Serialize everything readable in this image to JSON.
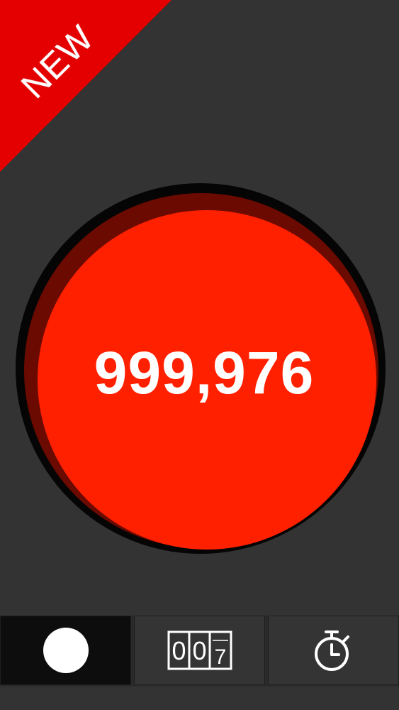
{
  "ribbon": {
    "label": "NEW",
    "color": "#e40000"
  },
  "counter": {
    "value": "999,976",
    "button_color": "#ff2000"
  },
  "tabs": [
    {
      "name": "tap-counter",
      "icon": "circle-dot-icon",
      "active": true
    },
    {
      "name": "tally-counter",
      "icon": "digit-counter-icon",
      "digits": [
        "0",
        "0",
        "7"
      ],
      "active": false
    },
    {
      "name": "stopwatch",
      "icon": "stopwatch-icon",
      "active": false
    }
  ],
  "colors": {
    "background": "#333333",
    "tab_active": "#0d0d0d",
    "tab_inactive": "#343434"
  }
}
